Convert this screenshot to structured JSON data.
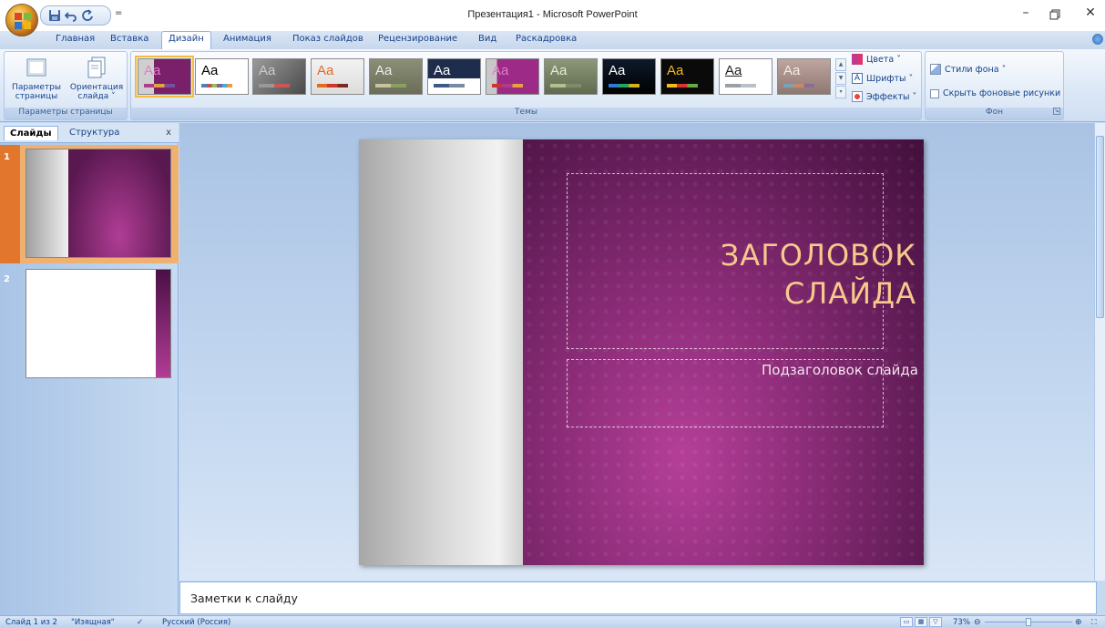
{
  "window": {
    "title": "Презентация1 - Microsoft PowerPoint",
    "controls": [
      "minimize",
      "restore",
      "close"
    ]
  },
  "qat": {
    "icons": [
      "save-icon",
      "undo-icon",
      "redo-icon"
    ],
    "more": "="
  },
  "tabs": [
    {
      "label": "Главная"
    },
    {
      "label": "Вставка"
    },
    {
      "label": "Дизайн",
      "active": true
    },
    {
      "label": "Анимация"
    },
    {
      "label": "Показ слайдов"
    },
    {
      "label": "Рецензирование"
    },
    {
      "label": "Вид"
    },
    {
      "label": "Раскадровка"
    }
  ],
  "ribbon": {
    "page_setup": {
      "page_params_line1": "Параметры",
      "page_params_line2": "страницы",
      "orientation_line1": "Ориентация",
      "orientation_line2": "слайда ˅",
      "group_label": "Параметры страницы"
    },
    "themes": {
      "group_label": "Темы",
      "items": [
        {
          "label": "Aa",
          "selected": true
        },
        {
          "label": "Aa"
        },
        {
          "label": "Aa"
        },
        {
          "label": "Aa"
        },
        {
          "label": "Aa"
        },
        {
          "label": "Aa"
        },
        {
          "label": "Aa"
        },
        {
          "label": "Aa"
        },
        {
          "label": "Aa"
        },
        {
          "label": "Aa"
        },
        {
          "label": "Aa"
        },
        {
          "label": "Aa"
        }
      ],
      "colors": "Цвета ˅",
      "fonts": "Шрифты ˅",
      "effects": "Эффекты ˅"
    },
    "background": {
      "styles": "Стили фона ˅",
      "hide_graphics": "Скрыть фоновые рисунки",
      "group_label": "Фон"
    }
  },
  "left_pane": {
    "tab_slides": "Слайды",
    "tab_outline": "Структура",
    "close": "x",
    "thumbnails": [
      {
        "num": "1"
      },
      {
        "num": "2"
      }
    ]
  },
  "slide": {
    "title_line1": "ЗАГОЛОВОК",
    "title_line2": "СЛАЙДА",
    "subtitle": "Подзаголовок слайда"
  },
  "notes": {
    "placeholder": "Заметки к слайду"
  },
  "status": {
    "slide_info": "Слайд 1 из 2",
    "theme": "\"Изящная\"",
    "language": "Русский (Россия)",
    "zoom": "73%",
    "zoom_fraction": 0.5
  }
}
